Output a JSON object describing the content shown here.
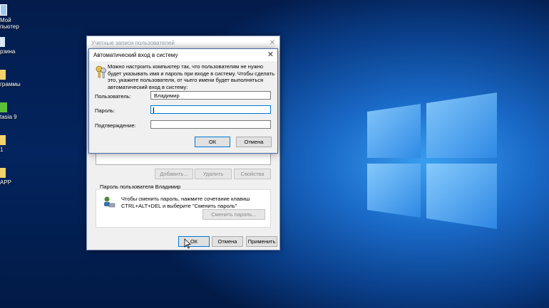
{
  "desktop": {
    "icons": [
      {
        "label_line1": "Мой",
        "label_line2": "пьютер"
      },
      {
        "label_line1": "рзина",
        "label_line2": ""
      },
      {
        "label_line1": "граммы",
        "label_line2": ""
      },
      {
        "label_line1": "tasia 9",
        "label_line2": ""
      },
      {
        "label_line1": "1",
        "label_line2": ""
      },
      {
        "label_line1": "APP",
        "label_line2": ""
      }
    ]
  },
  "back_window": {
    "title": "Учетные записи пользователей",
    "buttons": {
      "add": "Добавить...",
      "remove": "Удалить",
      "properties": "Свойства"
    },
    "password_group": {
      "title": "Пароль пользователя Владимир",
      "text_line1": "Чтобы сменить пароль, нажмите сочетание клавиш",
      "text_line2": "CTRL+ALT+DEL и выберите \"Сменить пароль\"",
      "change_button": "Сменить пароль..."
    },
    "footer": {
      "ok": "ОК",
      "cancel": "Отмена",
      "apply": "Применить"
    }
  },
  "dialog": {
    "title": "Автоматический вход в систему",
    "description": [
      "Можно настроить компьютер так, что пользователям не нужно",
      "будет указывать имя и пароль при входе в систему. Чтобы сделать",
      "это, укажите пользователя, от чьего имени будет выполняться",
      "автоматический вход в систему:"
    ],
    "username_label": "Пользователь:",
    "username_value": "Владимир",
    "password_label": "Пароль:",
    "password_value": "",
    "confirm_label": "Подтверждение:",
    "confirm_value": "",
    "ok": "ОК",
    "cancel": "Отмена"
  }
}
